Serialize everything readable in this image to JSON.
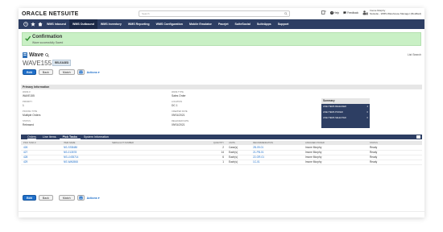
{
  "topbar": {
    "logo_main": "ORACLE",
    "logo_net": "NETSUITE",
    "search_placeholder": "Search",
    "help": "Help",
    "feedback": "Feedback",
    "user_name": "Imone Murphy",
    "user_role": "Netsuite - WMS Warehouse Manager (Modified)"
  },
  "nav": {
    "items": [
      {
        "label": "WMS Inbound",
        "active": false
      },
      {
        "label": "WMS Outbound",
        "active": true
      },
      {
        "label": "WMS Inventory",
        "active": false
      },
      {
        "label": "WMS Reporting",
        "active": false
      },
      {
        "label": "WMS Configuration",
        "active": false
      },
      {
        "label": "Mobile Emulator",
        "active": false
      },
      {
        "label": "Pacejet",
        "active": false
      },
      {
        "label": "SuiteSocial",
        "active": false
      },
      {
        "label": "SuiteApps",
        "active": false
      },
      {
        "label": "Support",
        "active": false
      }
    ]
  },
  "confirmation": {
    "title": "Confirmation",
    "message": "Wave successfully Saved"
  },
  "record": {
    "type": "Wave",
    "id": "WAVE155",
    "status_badge": "RELEASED",
    "list_search": "List  Search"
  },
  "buttons": {
    "edit": "Edit",
    "back": "Back",
    "match": "Match",
    "actions": "Actions ▾"
  },
  "primary_info": {
    "header": "Primary Information",
    "fields": [
      {
        "label": "WAVE #",
        "value": "WAVE155"
      },
      {
        "label": "PRIORITY",
        "value": "1"
      },
      {
        "label": "PICKING TYPE",
        "value": "Multiple Orders"
      },
      {
        "label": "STATUS",
        "value": "Released"
      },
      {
        "label": "WAVE TYPE",
        "value": "Sales Order"
      },
      {
        "label": "LOCATION",
        "value": "DC 1"
      },
      {
        "label": "CREATED DATE",
        "value": "09/01/2021"
      },
      {
        "label": "RELEASED DATE",
        "value": "09/01/2021"
      }
    ]
  },
  "summary": {
    "title": "Summary",
    "rows": [
      {
        "label": "LINE ITEMS RELEASED",
        "value": "4"
      },
      {
        "label": "LINE ITEMS PICKED",
        "value": "0"
      },
      {
        "label": "LINE ITEMS SELECTED",
        "value": "0"
      }
    ]
  },
  "subtabs": [
    "Orders",
    "Line Items",
    "Pick Tasks",
    "System Information"
  ],
  "table": {
    "headers": [
      "PICK TASK #",
      "ITEM NAME",
      "SERIAL/LOT NUMBER",
      "QUANTITY",
      "UNITS",
      "RECOMMENDATION",
      "ASSIGNED PICKER",
      "STATUS"
    ],
    "rows": [
      [
        "426",
        "NS-SSB480",
        "",
        "2",
        "Case(s)",
        "2B-09-01",
        "Imone Murphy",
        "Ready"
      ],
      [
        "427",
        "NS-013578",
        "",
        "14",
        "Each(s)",
        "21-PB-01",
        "Imone Murphy",
        "Ready"
      ],
      [
        "428",
        "NS-LN35714",
        "",
        "6",
        "Each(s)",
        "22-OR-01",
        "Imone Murphy",
        "Ready"
      ],
      [
        "429",
        "NS-WA0868",
        "",
        "1",
        "Each(s)",
        "1C-01",
        "Imone Murphy",
        "Ready"
      ]
    ]
  }
}
